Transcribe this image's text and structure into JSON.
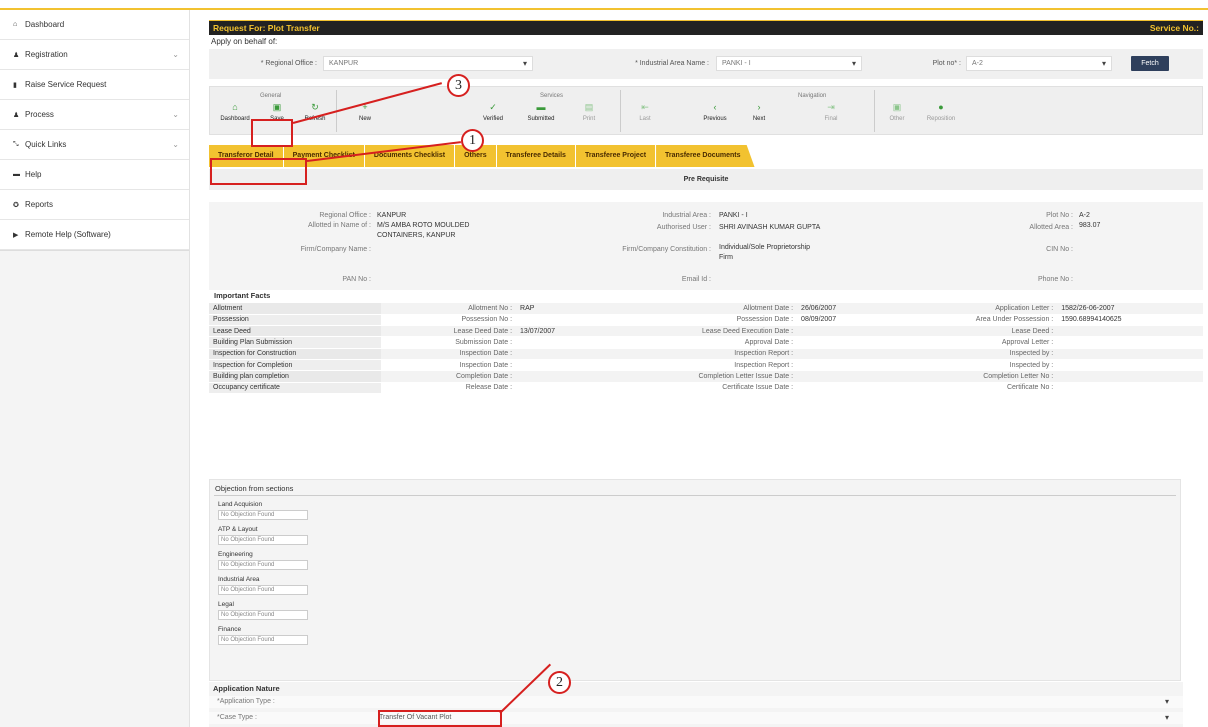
{
  "sidebar": {
    "items": [
      {
        "icon": "dashboard-icon",
        "glyph": "⌂",
        "label": "Dashboard",
        "chevron": false
      },
      {
        "icon": "registration-icon",
        "glyph": "♟",
        "label": "Registration",
        "chevron": true
      },
      {
        "icon": "service-request-icon",
        "glyph": "▮",
        "label": "Raise Service Request",
        "chevron": false
      },
      {
        "icon": "process-icon",
        "glyph": "♟",
        "label": "Process",
        "chevron": true
      },
      {
        "icon": "quick-links-icon",
        "glyph": "⤡",
        "label": "Quick Links",
        "chevron": true
      },
      {
        "icon": "help-icon",
        "glyph": "▬",
        "label": "Help",
        "chevron": false
      },
      {
        "icon": "reports-icon",
        "glyph": "✪",
        "label": "Reports",
        "chevron": false
      },
      {
        "icon": "remote-help-icon",
        "glyph": "▶",
        "label": "Remote Help (Software)",
        "chevron": false
      }
    ]
  },
  "header": {
    "title": "Request For: Plot Transfer",
    "service_no": "Service No.:"
  },
  "behalf": "Apply on behalf of:",
  "filters": {
    "regional_label": "* Regional Office :",
    "regional_value": "KANPUR",
    "area_label": "* Industrial Area Name :",
    "area_value": "PANKI - I",
    "plot_label": "Plot no* :",
    "plot_value": "A-2",
    "fetch": "Fetch"
  },
  "toolbar": {
    "groups": {
      "general": "General",
      "services": "Services",
      "navigation": "Navigation"
    },
    "buttons": {
      "dashboard": "Dashboard",
      "save": "Save",
      "refresh": "Refresh",
      "new": "New",
      "verified": "Verified",
      "submitted": "Submitted",
      "print": "Print",
      "last": "Last",
      "previous": "Previous",
      "next": "Next",
      "final": "Final",
      "other": "Other",
      "reposition": "Reposition"
    }
  },
  "tabs": [
    "Transferor Detail",
    "Payment Checklist",
    "Documents Checklist",
    "Others",
    "Transferee Details",
    "Transferee Project",
    "Transferee Documents"
  ],
  "prereq_title": "Pre Requisite",
  "info": {
    "regional_office_label": "Regional Office :",
    "regional_office": "KANPUR",
    "industrial_area_label": "Industrial Area :",
    "industrial_area": "PANKI - I",
    "plot_no_label": "Plot No :",
    "plot_no": "A-2",
    "allotted_name_label": "Allotted in Name of :",
    "allotted_name_1": "M/S AMBA ROTO MOULDED",
    "allotted_name_2": "CONTAINERS, KANPUR",
    "authorised_user_label": "Authorised User :",
    "authorised_user": "SHRI AVINASH KUMAR GUPTA",
    "allotted_area_label": "Allotted Area :",
    "allotted_area": "983.07",
    "firm_name_label": "Firm/Company Name :",
    "firm_const_label": "Firm/Company Constitution :",
    "firm_const_1": "Individual/Sole Proprietorship",
    "firm_const_2": "Firm",
    "cin_label": "CIN No :",
    "pan_label": "PAN No :",
    "email_label": "Email Id :",
    "phone_label": "Phone No :"
  },
  "facts": {
    "title": "Important Facts",
    "rows": [
      {
        "head": "Allotment",
        "c1": "Allotment No :",
        "v1": "RAP",
        "c2": "Allotment Date :",
        "v2": "26/06/2007",
        "c3": "Application Letter :",
        "v3": "1582/26-06-2007"
      },
      {
        "head": "Possession",
        "c1": "Possession No :",
        "v1": "",
        "c2": "Possession Date :",
        "v2": "08/09/2007",
        "c3": "Area Under Possession :",
        "v3": "1590.68994140625"
      },
      {
        "head": "Lease Deed",
        "c1": "Lease Deed Date :",
        "v1": "13/07/2007",
        "c2": "Lease Deed Execution Date :",
        "v2": "",
        "c3": "Lease Deed :",
        "v3": ""
      },
      {
        "head": "Building Plan Submission",
        "c1": "Submission Date :",
        "v1": "",
        "c2": "Approval Date :",
        "v2": "",
        "c3": "Approval Letter :",
        "v3": ""
      },
      {
        "head": "Inspection for Construction",
        "c1": "Inspection Date :",
        "v1": "",
        "c2": "Inspection Report :",
        "v2": "",
        "c3": "Inspected by :",
        "v3": ""
      },
      {
        "head": "Inspection for Completion",
        "c1": "Inspection Date :",
        "v1": "",
        "c2": "Inspection Report :",
        "v2": "",
        "c3": "Inspected by :",
        "v3": ""
      },
      {
        "head": "Building plan completion",
        "c1": "Completion Date :",
        "v1": "",
        "c2": "Completion Letter Issue Date :",
        "v2": "",
        "c3": "Completion Letter No :",
        "v3": ""
      },
      {
        "head": "Occupancy certificate",
        "c1": "Release Date :",
        "v1": "",
        "c2": "Certificate Issue Date :",
        "v2": "",
        "c3": "Certificate No :",
        "v3": ""
      }
    ]
  },
  "objection": {
    "title": "Objection from sections",
    "sections": [
      {
        "label": "Land Acquision",
        "value": "No Objection Found"
      },
      {
        "label": "ATP & Layout",
        "value": "No Objection Found"
      },
      {
        "label": "Engineering",
        "value": "No Objection Found"
      },
      {
        "label": "Industrial Area",
        "value": "No Objection Found"
      },
      {
        "label": "Legal",
        "value": "No Objection Found"
      },
      {
        "label": "Finance",
        "value": "No Objection Found"
      }
    ]
  },
  "application_nature": {
    "title": "Application Nature",
    "type_label": "*Application Type :",
    "type_value": "",
    "case_label": "*Case Type :",
    "case_value": "Transfer Of Vacant Plot"
  },
  "annotations": {
    "m1": "1",
    "m2": "2",
    "m3": "3",
    "color": "#d6201f"
  }
}
